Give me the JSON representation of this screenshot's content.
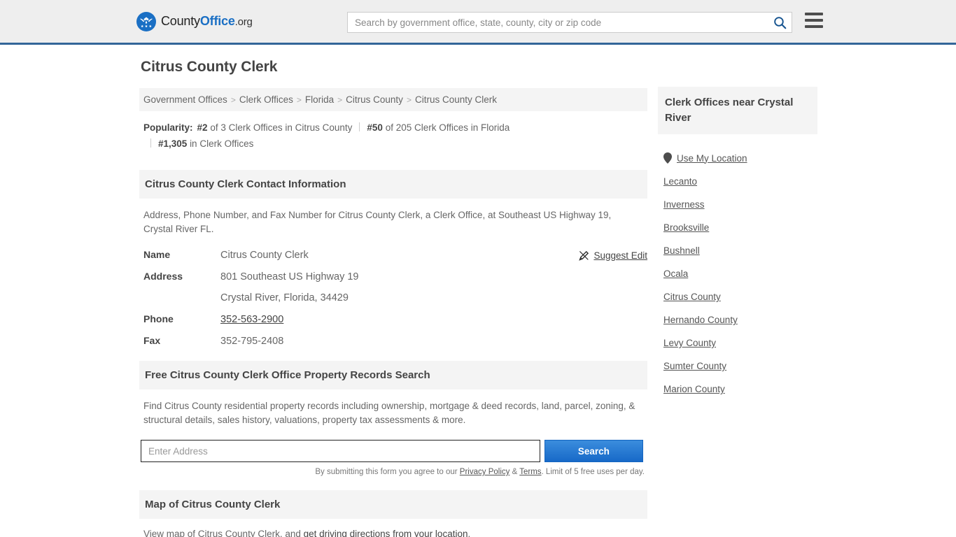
{
  "header": {
    "logo": {
      "part1": "County",
      "part2": "Office",
      "part3": ".org",
      "icon": "eagle-seal-icon"
    },
    "search": {
      "placeholder": "Search by government office, state, county, city or zip code",
      "value": "",
      "icon": "search-icon"
    },
    "menu_icon": "hamburger-menu-icon"
  },
  "page": {
    "title": "Citrus County Clerk"
  },
  "breadcrumb": {
    "separator": ">",
    "items": [
      {
        "label": "Government Offices"
      },
      {
        "label": "Clerk Offices"
      },
      {
        "label": "Florida"
      },
      {
        "label": "Citrus County"
      },
      {
        "label": "Citrus County Clerk"
      }
    ]
  },
  "popularity": {
    "label": "Popularity:",
    "entries": [
      {
        "rank": "#2",
        "text": "of 3 Clerk Offices in Citrus County"
      },
      {
        "rank": "#50",
        "text": "of 205 Clerk Offices in Florida"
      },
      {
        "rank": "#1,305",
        "text": "in Clerk Offices"
      }
    ]
  },
  "contact_section": {
    "heading": "Citrus County Clerk Contact Information",
    "description": "Address, Phone Number, and Fax Number for Citrus County Clerk, a Clerk Office, at Southeast US Highway 19, Crystal River FL.",
    "suggest_edit": {
      "label": "Suggest Edit",
      "icon": "edit-pencil-icon"
    },
    "rows": {
      "name_label": "Name",
      "name_value": "Citrus County Clerk",
      "address_label": "Address",
      "address_line1": "801 Southeast US Highway 19",
      "address_line2": "Crystal River, Florida, 34429",
      "phone_label": "Phone",
      "phone_value": "352-563-2900",
      "fax_label": "Fax",
      "fax_value": "352-795-2408"
    }
  },
  "property_search": {
    "heading": "Free Citrus County Clerk Office Property Records Search",
    "description": "Find Citrus County residential property records including ownership, mortgage & deed records, land, parcel, zoning, & structural details, sales history, valuations, property tax assessments & more.",
    "input_placeholder": "Enter Address",
    "input_value": "",
    "button_label": "Search",
    "disclaimer_prefix": "By submitting this form you agree to our ",
    "privacy_link": "Privacy Policy",
    "disclaimer_amp": " & ",
    "terms_link": "Terms",
    "disclaimer_suffix": ". Limit of 5 free uses per day."
  },
  "map_section": {
    "heading": "Map of Citrus County Clerk",
    "description_prefix": "View map of Citrus County Clerk, and ",
    "description_link": "get driving directions from your location",
    "description_suffix": "."
  },
  "sidebar": {
    "heading": "Clerk Offices near Crystal River",
    "use_my_location": {
      "label": "Use My Location",
      "icon": "map-pin-icon"
    },
    "items": [
      {
        "label": "Lecanto"
      },
      {
        "label": "Inverness"
      },
      {
        "label": "Brooksville"
      },
      {
        "label": "Bushnell"
      },
      {
        "label": "Ocala"
      },
      {
        "label": "Citrus County"
      },
      {
        "label": "Hernando County"
      },
      {
        "label": "Levy County"
      },
      {
        "label": "Sumter County"
      },
      {
        "label": "Marion County"
      }
    ]
  },
  "colors": {
    "header_bg": "#eeeeee",
    "header_rule": "#336699",
    "section_bg": "#f4f4f4",
    "brand_blue": "#1a6fc4",
    "button_blue": "#1769c8"
  }
}
